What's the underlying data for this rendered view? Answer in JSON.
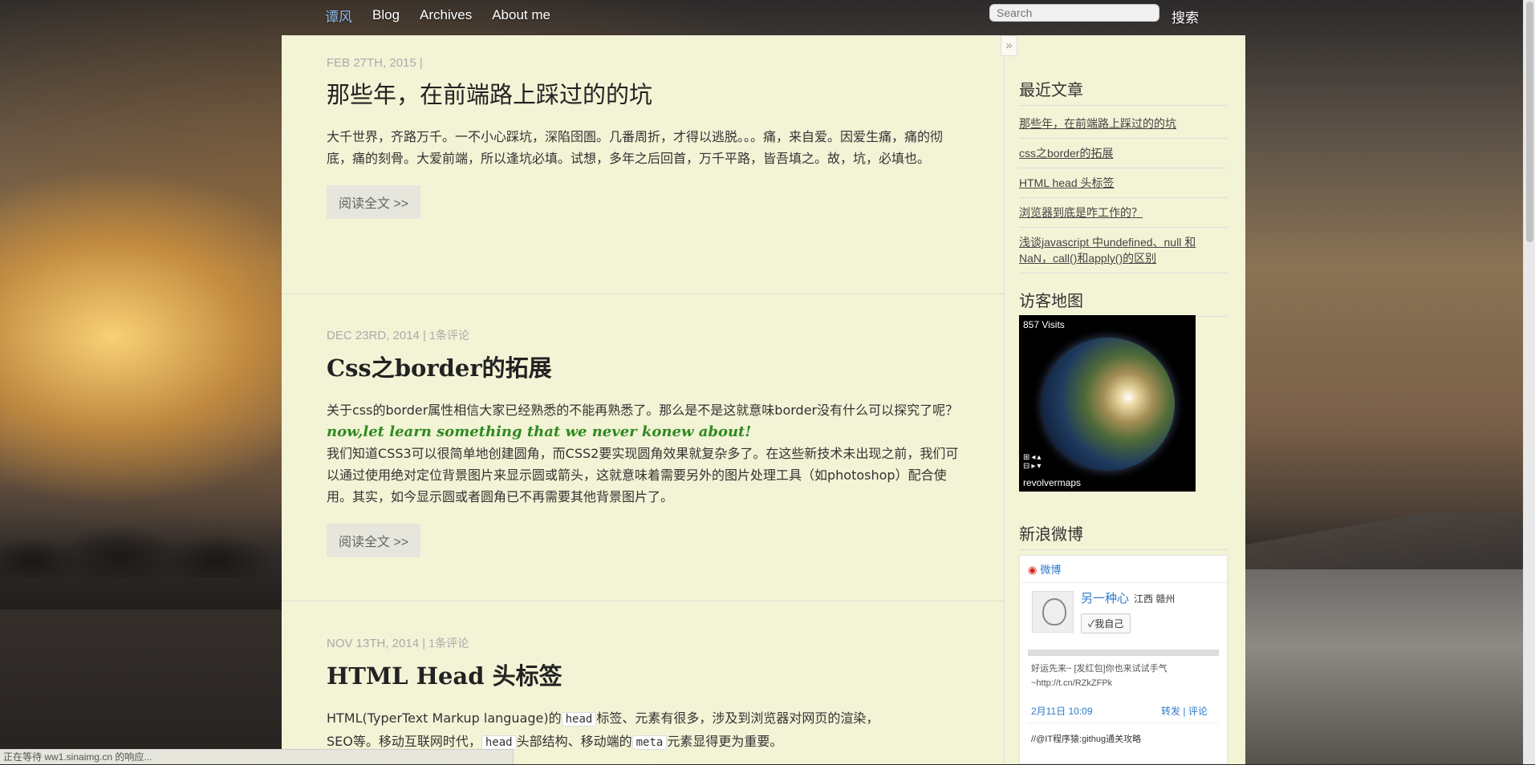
{
  "nav": {
    "brand": "谭风",
    "links": [
      "Blog",
      "Archives",
      "About me"
    ],
    "search_placeholder": "Search",
    "search_button": "搜索"
  },
  "collapse_label": "»",
  "articles": [
    {
      "meta": "FEB 27TH, 2015 |",
      "comments": "",
      "title": "那些年，在前端路上踩过的的坑",
      "paragraphs": [
        "大千世界，齐路万千。一不小心踩坑，深陷囹圄。几番周折，才得以逃脱。。。痛，来自爱。因爱生痛，痛的彻底，痛的刻骨。大爱前端，所以逢坑必填。试想，多年之后回首，万千平路，皆吾填之。故，坑，必填也。"
      ],
      "read_more": "阅读全文 >>"
    },
    {
      "meta": "DEC 23RD, 2014 |",
      "comments": "1条评论",
      "title": "Css之border的拓展",
      "p1": "关于css的border属性相信大家已经熟悉的不能再熟悉了。那么是不是这就意味border没有什么可以探究了呢？",
      "quote": "now,let learn something that we never konew about!",
      "p2": "我们知道CSS3可以很简单地创建圆角，而CSS2要实现圆角效果就复杂多了。在这些新技术未出现之前，我们可以通过使用绝对定位背景图片来显示圆或箭头，这就意味着需要另外的图片处理工具（如photoshop）配合使用。其实，如今显示圆或者圆角已不再需要其他背景图片了。",
      "read_more": "阅读全文 >>"
    },
    {
      "meta": "NOV 13TH, 2014 |",
      "comments": "1条评论",
      "title": "HTML Head 头标签",
      "p_a": "HTML(TyperText Markup language)的",
      "code1": "head",
      "p_b": "标签、元素有很多，涉及到浏览器对网页的渲染，",
      "p_c": "SEO等。移动互联网时代，",
      "code2": "head",
      "p_d": "头部结构、移动端的",
      "code3": "meta",
      "p_e": "元素显得更为重要。"
    }
  ],
  "sidebar": {
    "recent_title": "最近文章",
    "recent": [
      "那些年，在前端路上踩过的的坑",
      "css之border的拓展",
      "HTML head 头标签",
      "浏览器到底是咋工作的？",
      "浅谈javascript 中undefined、null 和 NaN，call()和apply()的区别"
    ],
    "map_title": "访客地图",
    "map_visits": "857 Visits",
    "map_brand": "revolvermaps",
    "weibo_title": "新浪微博",
    "weibo": {
      "header": "微博",
      "user": "另一种心",
      "location": "江西 赣州",
      "follow": "✓我自己",
      "text": "好运先来~ [发红包]你也来试试手气~http://t.cn/RZkZFPk",
      "time": "2月11日 10:09",
      "repost": "转发",
      "comment": "评论",
      "text2": "//@IT程序猿:githug通关攻略"
    }
  },
  "statusbar": "正在等待 ww1.sinaimg.cn 的响应..."
}
